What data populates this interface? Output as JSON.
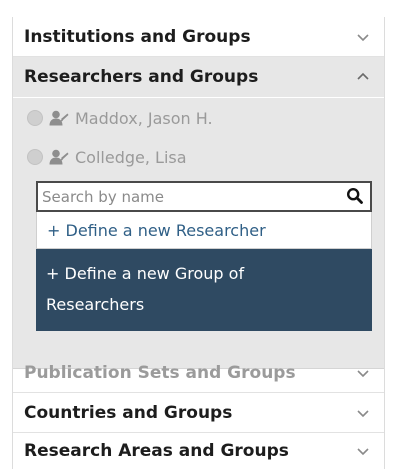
{
  "sections": {
    "institutions": {
      "label": "Institutions and Groups"
    },
    "researchers": {
      "label": "Researchers and Groups"
    },
    "publication_sets": {
      "label": "Publication Sets and Groups"
    },
    "countries": {
      "label": "Countries and Groups"
    },
    "research_areas": {
      "label": "Research Areas and Groups"
    }
  },
  "researchers_list": [
    {
      "name": "Maddox, Jason H."
    },
    {
      "name": "Colledge, Lisa"
    }
  ],
  "search": {
    "placeholder": "Search by name",
    "value": ""
  },
  "menu": {
    "new_researcher": "+ Define a new Researcher",
    "new_group": "+ Define a new Group of Researchers"
  },
  "colors": {
    "accent_dark": "#2f4a62",
    "link_blue": "#2f5f86",
    "expanded_bg": "#e7e7e7"
  },
  "icons": {
    "collapsed": "chevron-down-icon",
    "expanded": "chevron-up-icon",
    "search": "search-icon",
    "researcher": "person-icon"
  }
}
